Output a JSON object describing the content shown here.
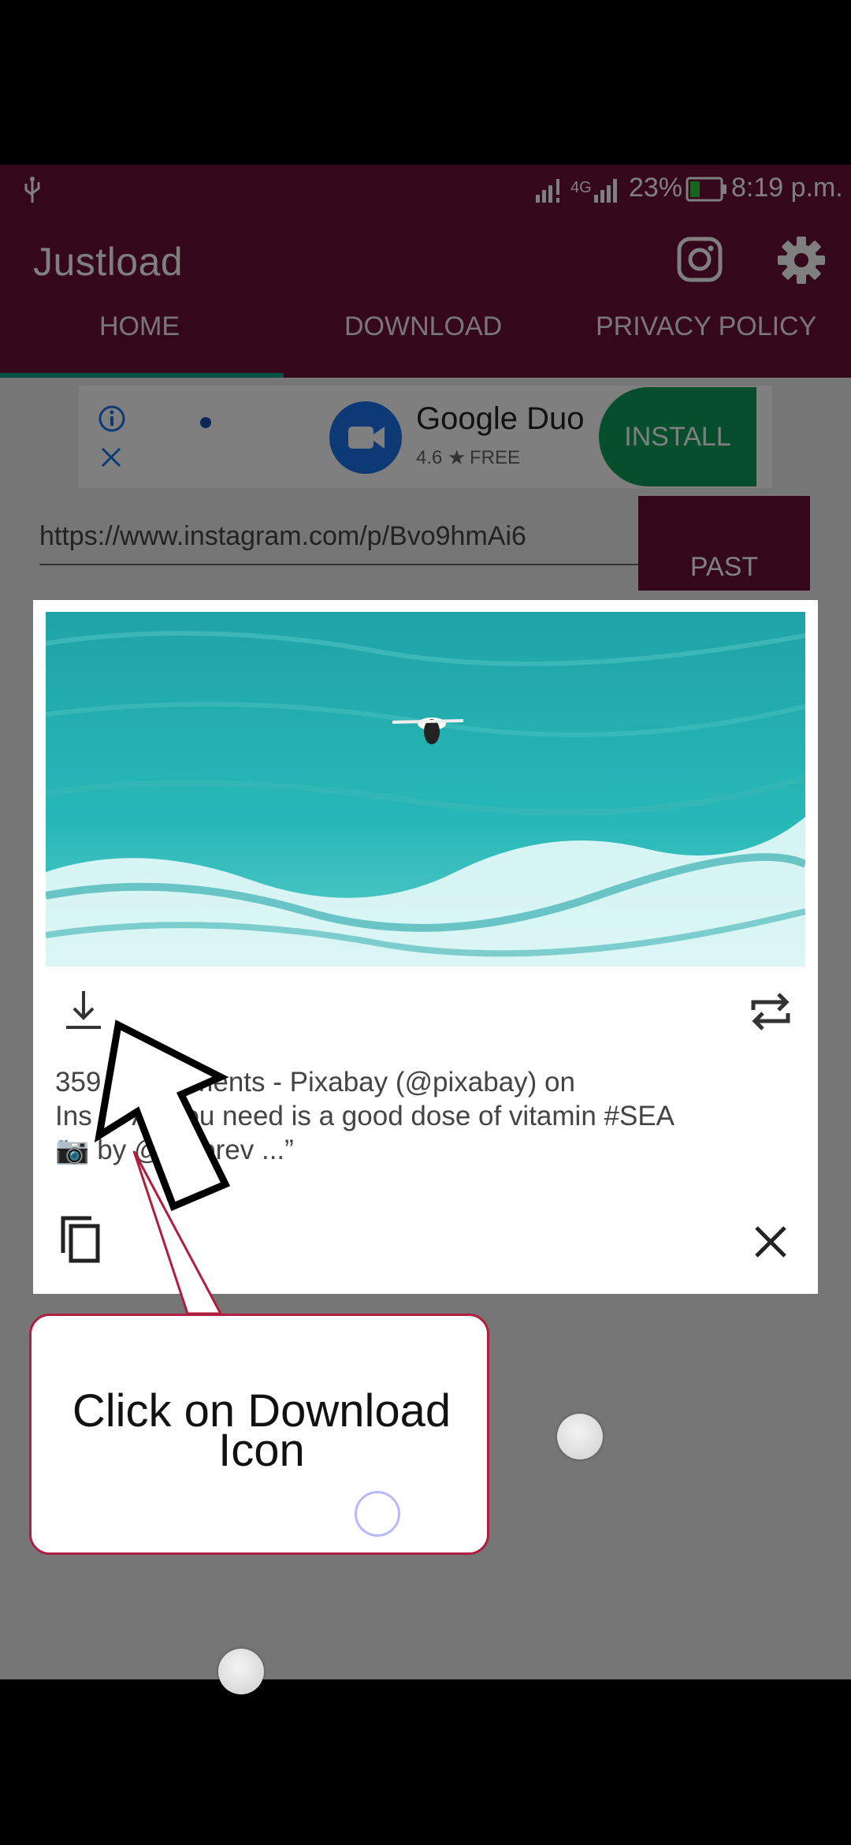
{
  "status_bar": {
    "usb_icon": "usb-icon",
    "network": "4G",
    "battery": "23%",
    "time": "8:19 p.m."
  },
  "app_bar": {
    "title": "Justload",
    "instagram_icon": "instagram-icon",
    "settings_icon": "gear-icon",
    "tabs": [
      {
        "label": "HOME",
        "active": true
      },
      {
        "label": "DOWNLOAD",
        "active": false
      },
      {
        "label": "PRIVACY POLICY",
        "active": false
      }
    ]
  },
  "ad": {
    "app_name": "Google Duo",
    "rating": "4.6",
    "price": "FREE",
    "install_label": "INSTALL"
  },
  "url_input": {
    "value": "https://www.instagram.com/p/Bvo9hmAi6",
    "paste_label": "PAST"
  },
  "dialog": {
    "caption_line1": "359   2 Comments - Pixabay (@pixabay) on",
    "caption_line2": "Ins g     “All you need is a good dose of vitamin #SEA",
    "caption_line3": "📷 by @   dobrev                            ...”",
    "download_icon": "download-icon",
    "repost_icon": "repost-icon",
    "copy_icon": "copy-icon",
    "close_icon": "close-icon"
  },
  "tooltip": {
    "line1": "Click on Download",
    "line2": "Icon"
  },
  "colors": {
    "primary": "#6a0f35",
    "accent": "#0f9d58",
    "tab_indicator": "#00a08a",
    "tooltip_border": "#b01e3f"
  }
}
